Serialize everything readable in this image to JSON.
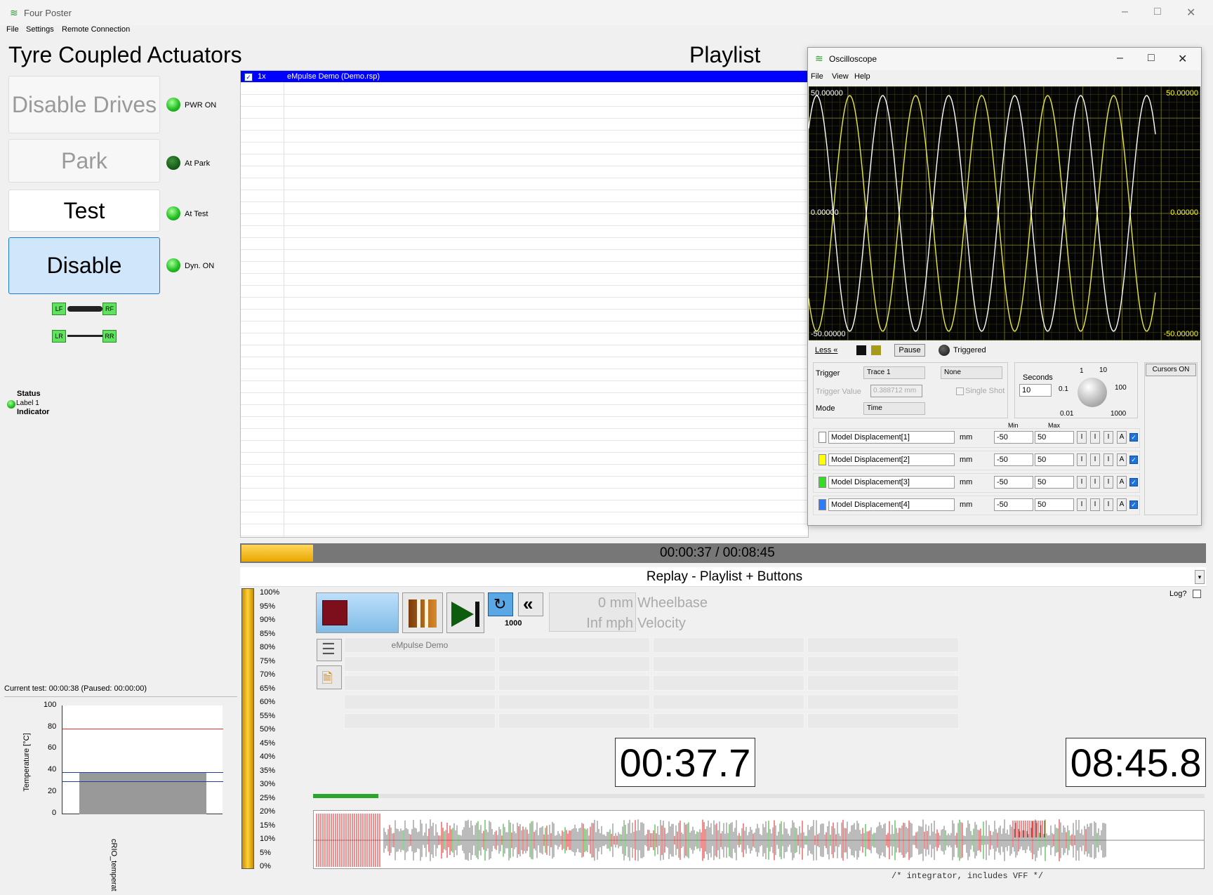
{
  "window": {
    "title": "Four Poster",
    "menu": [
      "File",
      "Settings",
      "Remote Connection"
    ]
  },
  "left": {
    "heading": "Tyre Coupled Actuators",
    "buttons": [
      "Disable Drives",
      "Park",
      "Test",
      "Disable"
    ],
    "indicators": [
      "PWR ON",
      "At Park",
      "At Test",
      "Dyn. ON"
    ],
    "wheels": [
      "LF",
      "RF",
      "LR",
      "RR"
    ],
    "status": {
      "title": "Status",
      "label": "Label 1",
      "indicator": "Indicator"
    },
    "current_test": "Current test: 00:00:38 (Paused: 00:00:00)",
    "temp_chart": {
      "ylabel": "Temperature  [°C]",
      "yticks": [
        "100",
        "80",
        "60",
        "40",
        "20",
        "0"
      ],
      "xlabel": "cRIO_temperat"
    }
  },
  "playlist": {
    "heading": "Playlist",
    "row": {
      "count": "1x",
      "name": "eMpulse Demo  (Demo.rsp)"
    }
  },
  "progress": {
    "time": "00:00:37 / 00:08:45",
    "fraction": 0.07
  },
  "replay": {
    "title": "Replay - Playlist + Buttons",
    "log": "Log?",
    "loop_count": "1000",
    "wheelbase_value": "0 mm",
    "wheelbase_label": "Wheelbase",
    "velocity_value": "Inf mph",
    "velocity_label": "Velocity",
    "grid_first": "eMpulse Demo",
    "elapsed": "00:37.7",
    "total": "08:45.8",
    "bar_fraction": 0.08,
    "percent_ticks": [
      "100%",
      "95%",
      "90%",
      "85%",
      "80%",
      "75%",
      "70%",
      "65%",
      "60%",
      "55%",
      "50%",
      "45%",
      "40%",
      "35%",
      "30%",
      "25%",
      "20%",
      "15%",
      "10%",
      "5%",
      "0%"
    ]
  },
  "oscilloscope": {
    "title": "Oscilloscope",
    "menu": [
      "File",
      "View",
      "Help"
    ],
    "ymax": "50.00000",
    "yzero": "0.00000",
    "ymin": "-50.00000",
    "less": "Less «",
    "pause": "Pause",
    "triggered": "Triggered",
    "trigger_label": "Trigger",
    "trigger_source": "Trace 1",
    "trigger_edge": "None",
    "trigger_value_label": "Trigger Value",
    "trigger_value": "0.388712 mm",
    "single_shot": "Single Shot",
    "mode_label": "Mode",
    "mode": "Time",
    "seconds_label": "Seconds",
    "seconds": "10",
    "knob_ticks": [
      "1",
      "10",
      "0.1",
      "100",
      "0.01",
      "1000"
    ],
    "cursors": "Cursors ON",
    "min_label": "Min",
    "max_label": "Max",
    "traces": [
      {
        "name": "Model Displacement[1]",
        "unit": "mm",
        "min": "-50",
        "max": "50",
        "color": "#ffffff"
      },
      {
        "name": "Model Displacement[2]",
        "unit": "mm",
        "min": "-50",
        "max": "50",
        "color": "#ffff00"
      },
      {
        "name": "Model Displacement[3]",
        "unit": "mm",
        "min": "-50",
        "max": "50",
        "color": "#33dd22"
      },
      {
        "name": "Model Displacement[4]",
        "unit": "mm",
        "min": "-50",
        "max": "50",
        "color": "#2a7dff"
      }
    ]
  },
  "footer_code": "/* integrator, includes VFF */"
}
